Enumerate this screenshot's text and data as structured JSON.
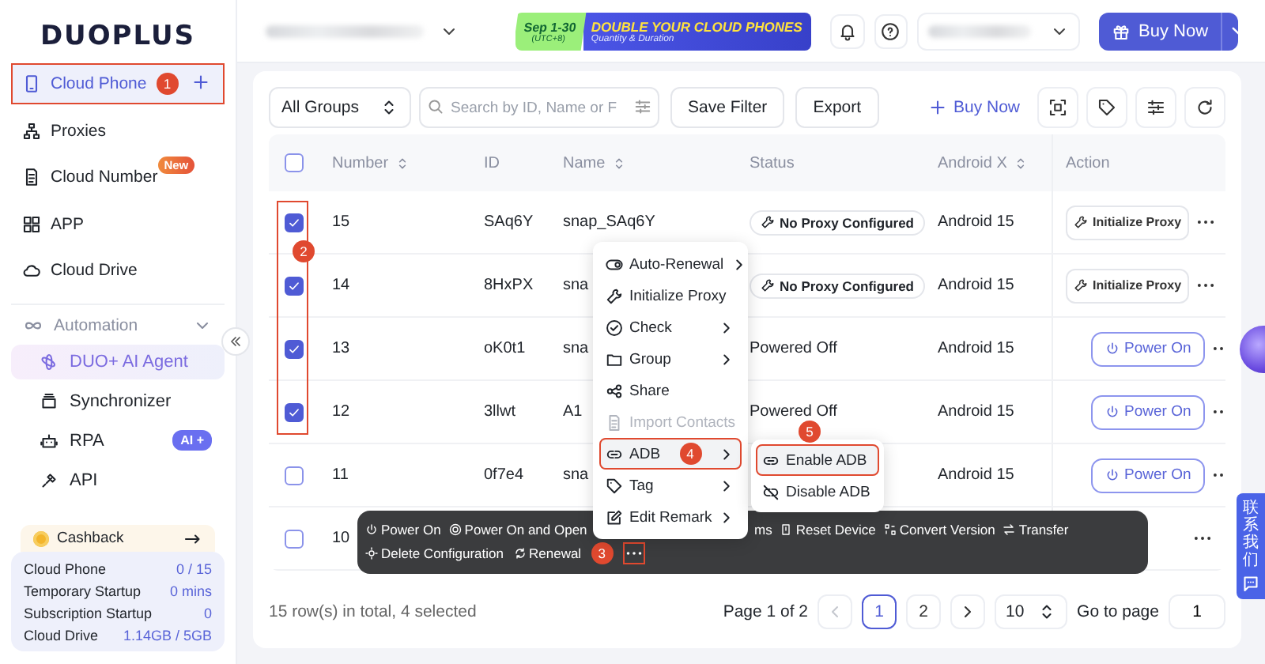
{
  "logo": "DUOPLUS",
  "promo": {
    "date": "Sep 1-30",
    "timezone": "(UTC+8)",
    "headline": "DOUBLE YOUR CLOUD PHONES",
    "subline": "Quantity & Duration"
  },
  "header_button": {
    "label": "Buy Now"
  },
  "sidebar": {
    "items": [
      {
        "label": "Cloud Phone",
        "selected": true,
        "add_button": true,
        "marker": "1"
      },
      {
        "label": "Proxies",
        "selected": false
      },
      {
        "label": "Cloud Number",
        "selected": false,
        "badge": "New"
      },
      {
        "label": "APP",
        "selected": false
      },
      {
        "label": "Cloud Drive",
        "selected": false
      }
    ],
    "section": {
      "label": "Automation",
      "expanded": true,
      "items": [
        {
          "label": "DUO+ AI Agent",
          "selected": true
        },
        {
          "label": "Synchronizer",
          "selected": false
        },
        {
          "label": "RPA",
          "selected": false,
          "badge": "AI +"
        },
        {
          "label": "API",
          "selected": false
        }
      ]
    },
    "cashback": "Cashback",
    "stats": [
      {
        "label": "Cloud Phone",
        "value": "0 / 15"
      },
      {
        "label": "Temporary Startup",
        "value": "0 mins"
      },
      {
        "label": "Subscription Startup",
        "value": "0"
      },
      {
        "label": "Cloud Drive",
        "value": "1.14GB / 5GB"
      }
    ]
  },
  "toolbar": {
    "group_select": "All Groups",
    "search_placeholder": "Search by ID, Name or F",
    "buttons": [
      "Save Filter",
      "Export"
    ],
    "buy_link": "Buy Now"
  },
  "table": {
    "select_all": false,
    "selection_marker": "2",
    "columns": [
      {
        "label": "Number",
        "sortable": true
      },
      {
        "label": "ID",
        "sortable": false
      },
      {
        "label": "Name",
        "sortable": true
      },
      {
        "label": "Status",
        "sortable": false
      },
      {
        "label": "Android X",
        "sortable": true
      },
      {
        "label": "Action",
        "sortable": false
      }
    ],
    "rows": [
      {
        "selected": true,
        "number": "15",
        "id": "SAq6Y",
        "name": "snap_SAq6Y",
        "status": {
          "kind": "badge",
          "text": "No Proxy Configured"
        },
        "android": "Android 15",
        "action": {
          "kind": "init_proxy",
          "label": "Initialize Proxy"
        }
      },
      {
        "selected": true,
        "number": "14",
        "id": "8HxPX",
        "name": "sna",
        "status": {
          "kind": "badge",
          "text": "No Proxy Configured"
        },
        "android": "Android 15",
        "action": {
          "kind": "init_proxy",
          "label": "Initialize Proxy"
        }
      },
      {
        "selected": true,
        "number": "13",
        "id": "oK0t1",
        "name": "sna",
        "status": {
          "kind": "text",
          "text": "Powered Off"
        },
        "android": "Android 15",
        "action": {
          "kind": "power_on",
          "label": "Power On"
        }
      },
      {
        "selected": true,
        "number": "12",
        "id": "3llwt",
        "name": "A1",
        "status": {
          "kind": "text",
          "text": "Powered Off"
        },
        "android": "Android 15",
        "action": {
          "kind": "power_on",
          "label": "Power On"
        }
      },
      {
        "selected": false,
        "number": "11",
        "id": "0f7e4",
        "name": "sna",
        "android": "Android 15",
        "action": {
          "kind": "power_on",
          "label": "Power On"
        }
      },
      {
        "selected": false,
        "number": "10"
      }
    ]
  },
  "context_menu": {
    "items": [
      {
        "label": "Auto-Renewal",
        "submenu": true,
        "disabled": false,
        "selected": false
      },
      {
        "label": "Initialize Proxy",
        "submenu": false,
        "disabled": false,
        "selected": false
      },
      {
        "label": "Check",
        "submenu": true,
        "disabled": false,
        "selected": false
      },
      {
        "label": "Group",
        "submenu": true,
        "disabled": false,
        "selected": false
      },
      {
        "label": "Share",
        "submenu": false,
        "disabled": false,
        "selected": false
      },
      {
        "label": "Import Contacts",
        "submenu": false,
        "disabled": true,
        "selected": false
      },
      {
        "label": "ADB",
        "submenu": true,
        "disabled": false,
        "selected": true,
        "marker": "4"
      },
      {
        "label": "Tag",
        "submenu": true,
        "disabled": false,
        "selected": false
      },
      {
        "label": "Edit Remark",
        "submenu": true,
        "disabled": false,
        "selected": false
      }
    ]
  },
  "submenu": {
    "items": [
      {
        "label": "Enable ADB",
        "selected": true,
        "marker": "5"
      },
      {
        "label": "Disable ADB",
        "selected": false
      }
    ]
  },
  "bulk_bar": {
    "before_menu": [
      "Power On",
      "Power On and Open"
    ],
    "after_menu": [
      "ms",
      "Reset Device",
      "Convert Version",
      "Transfer"
    ],
    "second_row": [
      "Delete Configuration",
      "Renewal"
    ],
    "more_marker": "3"
  },
  "footer": {
    "summary": "15 row(s) in total, 4 selected",
    "page_label": "Page 1 of 2",
    "prev_disabled": true,
    "pages": [
      {
        "label": "1",
        "selected": true
      },
      {
        "label": "2",
        "selected": false
      }
    ],
    "page_size": "10",
    "goto_label": "Go to page",
    "goto_value": "1"
  },
  "contact_tab": "联系我们"
}
